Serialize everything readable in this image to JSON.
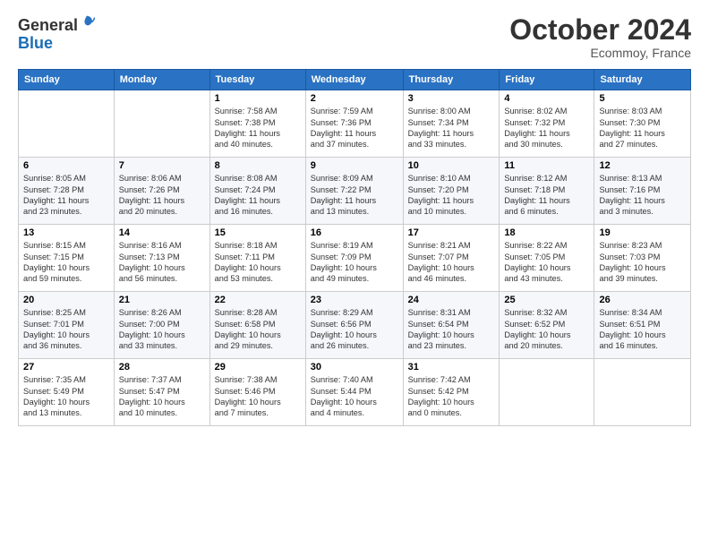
{
  "header": {
    "logo_line1": "General",
    "logo_line2": "Blue",
    "month": "October 2024",
    "location": "Ecommoy, France"
  },
  "days_of_week": [
    "Sunday",
    "Monday",
    "Tuesday",
    "Wednesday",
    "Thursday",
    "Friday",
    "Saturday"
  ],
  "weeks": [
    [
      {
        "num": "",
        "info": ""
      },
      {
        "num": "",
        "info": ""
      },
      {
        "num": "1",
        "info": "Sunrise: 7:58 AM\nSunset: 7:38 PM\nDaylight: 11 hours\nand 40 minutes."
      },
      {
        "num": "2",
        "info": "Sunrise: 7:59 AM\nSunset: 7:36 PM\nDaylight: 11 hours\nand 37 minutes."
      },
      {
        "num": "3",
        "info": "Sunrise: 8:00 AM\nSunset: 7:34 PM\nDaylight: 11 hours\nand 33 minutes."
      },
      {
        "num": "4",
        "info": "Sunrise: 8:02 AM\nSunset: 7:32 PM\nDaylight: 11 hours\nand 30 minutes."
      },
      {
        "num": "5",
        "info": "Sunrise: 8:03 AM\nSunset: 7:30 PM\nDaylight: 11 hours\nand 27 minutes."
      }
    ],
    [
      {
        "num": "6",
        "info": "Sunrise: 8:05 AM\nSunset: 7:28 PM\nDaylight: 11 hours\nand 23 minutes."
      },
      {
        "num": "7",
        "info": "Sunrise: 8:06 AM\nSunset: 7:26 PM\nDaylight: 11 hours\nand 20 minutes."
      },
      {
        "num": "8",
        "info": "Sunrise: 8:08 AM\nSunset: 7:24 PM\nDaylight: 11 hours\nand 16 minutes."
      },
      {
        "num": "9",
        "info": "Sunrise: 8:09 AM\nSunset: 7:22 PM\nDaylight: 11 hours\nand 13 minutes."
      },
      {
        "num": "10",
        "info": "Sunrise: 8:10 AM\nSunset: 7:20 PM\nDaylight: 11 hours\nand 10 minutes."
      },
      {
        "num": "11",
        "info": "Sunrise: 8:12 AM\nSunset: 7:18 PM\nDaylight: 11 hours\nand 6 minutes."
      },
      {
        "num": "12",
        "info": "Sunrise: 8:13 AM\nSunset: 7:16 PM\nDaylight: 11 hours\nand 3 minutes."
      }
    ],
    [
      {
        "num": "13",
        "info": "Sunrise: 8:15 AM\nSunset: 7:15 PM\nDaylight: 10 hours\nand 59 minutes."
      },
      {
        "num": "14",
        "info": "Sunrise: 8:16 AM\nSunset: 7:13 PM\nDaylight: 10 hours\nand 56 minutes."
      },
      {
        "num": "15",
        "info": "Sunrise: 8:18 AM\nSunset: 7:11 PM\nDaylight: 10 hours\nand 53 minutes."
      },
      {
        "num": "16",
        "info": "Sunrise: 8:19 AM\nSunset: 7:09 PM\nDaylight: 10 hours\nand 49 minutes."
      },
      {
        "num": "17",
        "info": "Sunrise: 8:21 AM\nSunset: 7:07 PM\nDaylight: 10 hours\nand 46 minutes."
      },
      {
        "num": "18",
        "info": "Sunrise: 8:22 AM\nSunset: 7:05 PM\nDaylight: 10 hours\nand 43 minutes."
      },
      {
        "num": "19",
        "info": "Sunrise: 8:23 AM\nSunset: 7:03 PM\nDaylight: 10 hours\nand 39 minutes."
      }
    ],
    [
      {
        "num": "20",
        "info": "Sunrise: 8:25 AM\nSunset: 7:01 PM\nDaylight: 10 hours\nand 36 minutes."
      },
      {
        "num": "21",
        "info": "Sunrise: 8:26 AM\nSunset: 7:00 PM\nDaylight: 10 hours\nand 33 minutes."
      },
      {
        "num": "22",
        "info": "Sunrise: 8:28 AM\nSunset: 6:58 PM\nDaylight: 10 hours\nand 29 minutes."
      },
      {
        "num": "23",
        "info": "Sunrise: 8:29 AM\nSunset: 6:56 PM\nDaylight: 10 hours\nand 26 minutes."
      },
      {
        "num": "24",
        "info": "Sunrise: 8:31 AM\nSunset: 6:54 PM\nDaylight: 10 hours\nand 23 minutes."
      },
      {
        "num": "25",
        "info": "Sunrise: 8:32 AM\nSunset: 6:52 PM\nDaylight: 10 hours\nand 20 minutes."
      },
      {
        "num": "26",
        "info": "Sunrise: 8:34 AM\nSunset: 6:51 PM\nDaylight: 10 hours\nand 16 minutes."
      }
    ],
    [
      {
        "num": "27",
        "info": "Sunrise: 7:35 AM\nSunset: 5:49 PM\nDaylight: 10 hours\nand 13 minutes."
      },
      {
        "num": "28",
        "info": "Sunrise: 7:37 AM\nSunset: 5:47 PM\nDaylight: 10 hours\nand 10 minutes."
      },
      {
        "num": "29",
        "info": "Sunrise: 7:38 AM\nSunset: 5:46 PM\nDaylight: 10 hours\nand 7 minutes."
      },
      {
        "num": "30",
        "info": "Sunrise: 7:40 AM\nSunset: 5:44 PM\nDaylight: 10 hours\nand 4 minutes."
      },
      {
        "num": "31",
        "info": "Sunrise: 7:42 AM\nSunset: 5:42 PM\nDaylight: 10 hours\nand 0 minutes."
      },
      {
        "num": "",
        "info": ""
      },
      {
        "num": "",
        "info": ""
      }
    ]
  ]
}
